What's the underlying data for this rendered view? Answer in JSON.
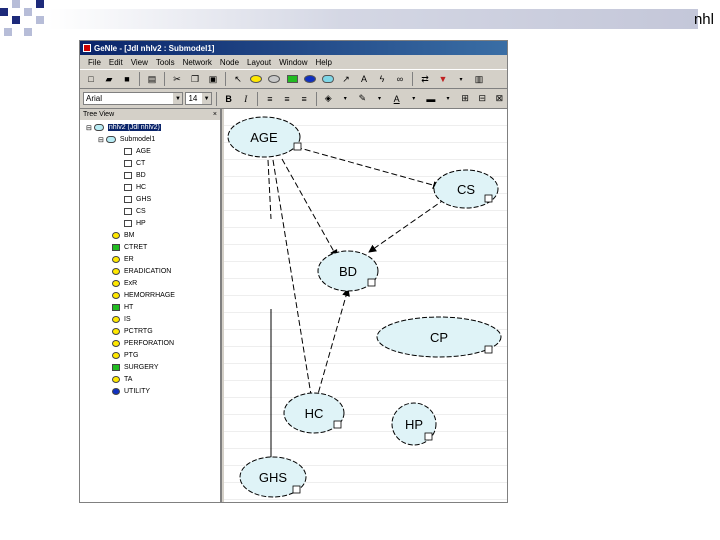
{
  "slide": {
    "title": "nhl"
  },
  "window": {
    "title": "GeNIe - [Jdl nhlv2 : Submodel1]"
  },
  "menu": [
    "File",
    "Edit",
    "View",
    "Tools",
    "Network",
    "Node",
    "Layout",
    "Window",
    "Help"
  ],
  "format": {
    "font": "Arial",
    "size": "14"
  },
  "tree": {
    "header": "Tree View",
    "root": "nhlv2 (Jdl nhlv2)",
    "submodel": "Submodel1",
    "sub_items": [
      "AGE",
      "CT",
      "BD",
      "HC",
      "GHS",
      "CS",
      "HP"
    ],
    "items": [
      {
        "label": "BM",
        "color": "yellow"
      },
      {
        "label": "CTRET",
        "color": "green"
      },
      {
        "label": "ER",
        "color": "yellow"
      },
      {
        "label": "ERADICATION",
        "color": "yellow"
      },
      {
        "label": "ExR",
        "color": "yellow"
      },
      {
        "label": "HEMORRHAGE",
        "color": "yellow"
      },
      {
        "label": "HT",
        "color": "green"
      },
      {
        "label": "IS",
        "color": "yellow"
      },
      {
        "label": "PCTRTG",
        "color": "yellow"
      },
      {
        "label": "PERFORATION",
        "color": "yellow"
      },
      {
        "label": "PTG",
        "color": "yellow"
      },
      {
        "label": "SURGERY",
        "color": "green"
      },
      {
        "label": "TA",
        "color": "yellow"
      },
      {
        "label": "UTILITY",
        "color": "blue"
      }
    ]
  },
  "graph": {
    "node_fill": "#dff3f7",
    "nodes": [
      {
        "id": "AGE",
        "label": "AGE"
      },
      {
        "id": "CS",
        "label": "CS"
      },
      {
        "id": "BD",
        "label": "BD"
      },
      {
        "id": "CP",
        "label": "CP"
      },
      {
        "id": "HC",
        "label": "HC"
      },
      {
        "id": "HP",
        "label": "HP"
      },
      {
        "id": "GHS",
        "label": "GHS"
      }
    ]
  }
}
